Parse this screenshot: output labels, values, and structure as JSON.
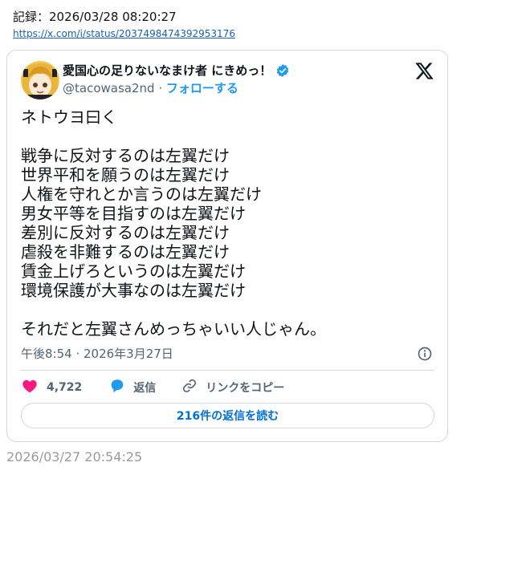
{
  "header": {
    "record_label": "記録：2026/03/28 08:20:27",
    "link_text": "https://x.com/i/status/2037498474392953176"
  },
  "tweet": {
    "display_name": "愛国心の足りないなまけ者 にきめっ！",
    "handle": "@tacowasa2nd",
    "separator": " · ",
    "follow_label": "フォローする",
    "lines": [
      "ネトウヨ曰く",
      "",
      "戦争に反対するのは左翼だけ",
      "世界平和を願うのは左翼だけ",
      "人権を守れとか言うのは左翼だけ",
      "男女平等を目指すのは左翼だけ",
      "差別に反対するのは左翼だけ",
      "虐殺を非難するのは左翼だけ",
      "賃金上げろというのは左翼だけ",
      "環境保護が大事なのは左翼だけ",
      "",
      "それだと左翼さんめっちゃいい人じゃん。"
    ],
    "timestamp": "午後8:54 · 2026年3月27日",
    "like_count": "4,722",
    "reply_label": "返信",
    "copy_link_label": "リンクをコピー",
    "read_replies_label": "216件の返信を読む"
  },
  "footer": {
    "timestamp": "2026/03/27 20:54:25"
  },
  "colors": {
    "accent_blue": "#1d9bf0",
    "like_pink": "#f91880",
    "muted": "#536471",
    "border": "#cfd9de"
  },
  "icons": [
    "avatar",
    "verified-badge-icon",
    "x-logo-icon",
    "info-icon",
    "heart-icon",
    "reply-bubble-icon",
    "link-icon"
  ]
}
